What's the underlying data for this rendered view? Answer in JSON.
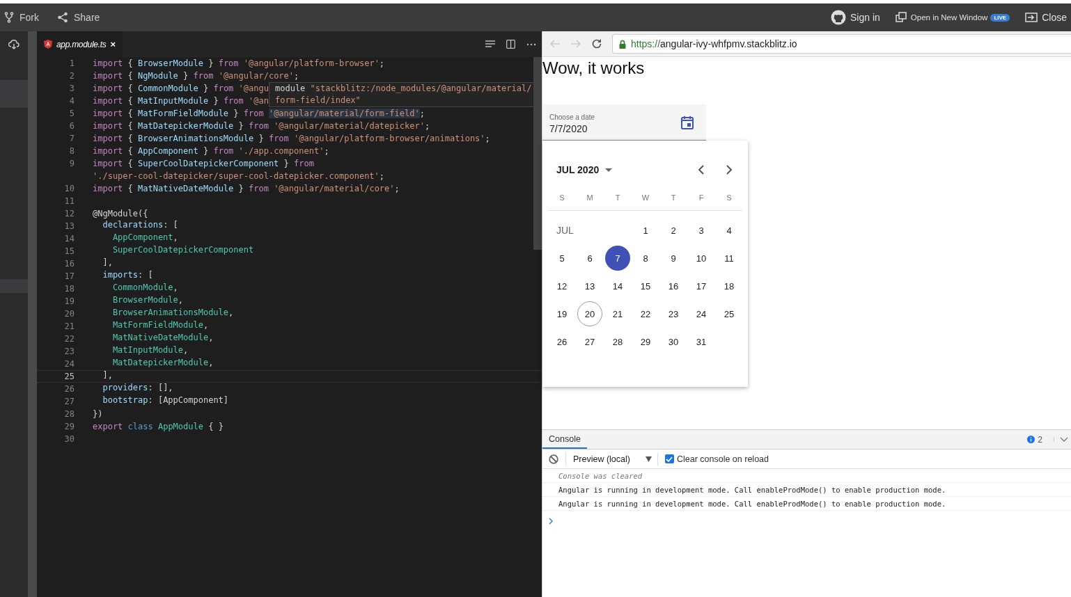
{
  "top_bar": {
    "left_actions": [
      {
        "label": "Fork"
      },
      {
        "label": "Share"
      }
    ],
    "right_actions": [
      {
        "label": "Sign in"
      },
      {
        "label": "Open in New Window",
        "badge": "LIVE"
      },
      {
        "label": "Close"
      }
    ]
  },
  "editor": {
    "tabs": [
      {
        "label": "app.module.ts",
        "close": "×",
        "selected": true
      }
    ],
    "lines": [
      {
        "num": "1",
        "current": false,
        "tokens": [
          {
            "kind": "kw",
            "text": "import"
          },
          {
            "kind": "p",
            "text": " { "
          },
          {
            "kind": "id",
            "text": "BrowserModule"
          },
          {
            "kind": "p",
            "text": " } "
          },
          {
            "kind": "kw",
            "text": "from"
          },
          {
            "kind": "str",
            "text": " '@angular/platform-browser'"
          },
          {
            "kind": "p",
            "text": ";"
          }
        ]
      },
      {
        "num": "2",
        "current": false,
        "tokens": [
          {
            "kind": "kw",
            "text": "import"
          },
          {
            "kind": "p",
            "text": " { "
          },
          {
            "kind": "id",
            "text": "NgModule"
          },
          {
            "kind": "p",
            "text": " } "
          },
          {
            "kind": "kw",
            "text": "from"
          },
          {
            "kind": "str",
            "text": " '@angular/core'"
          },
          {
            "kind": "p",
            "text": ";"
          }
        ]
      },
      {
        "num": "3",
        "current": false,
        "tokens": [
          {
            "kind": "kw",
            "text": "import"
          },
          {
            "kind": "p",
            "text": " { "
          },
          {
            "kind": "id",
            "text": "CommonModule"
          },
          {
            "kind": "p",
            "text": " } "
          },
          {
            "kind": "kw",
            "text": "from"
          },
          {
            "kind": "str",
            "text": " '@angu"
          }
        ]
      },
      {
        "num": "4",
        "current": false,
        "tokens": [
          {
            "kind": "kw",
            "text": "import"
          },
          {
            "kind": "p",
            "text": " { "
          },
          {
            "kind": "id",
            "text": "MatInputModule"
          },
          {
            "kind": "p",
            "text": " } "
          },
          {
            "kind": "kw",
            "text": "from"
          },
          {
            "kind": "str",
            "text": " '@an"
          }
        ]
      },
      {
        "num": "5",
        "current": false,
        "tokens": [
          {
            "kind": "kw",
            "text": "import"
          },
          {
            "kind": "p",
            "text": " { "
          },
          {
            "kind": "id",
            "text": "MatFormFieldModule"
          },
          {
            "kind": "p",
            "text": " } "
          },
          {
            "kind": "kw",
            "text": "from "
          },
          {
            "kind": "strhl",
            "text": "'@angular/material/form-field'"
          },
          {
            "kind": "p",
            "text": ";"
          }
        ]
      },
      {
        "num": "6",
        "current": false,
        "tokens": [
          {
            "kind": "kw",
            "text": "import"
          },
          {
            "kind": "p",
            "text": " { "
          },
          {
            "kind": "id",
            "text": "MatDatepickerModule"
          },
          {
            "kind": "p",
            "text": " } "
          },
          {
            "kind": "kw",
            "text": "from"
          },
          {
            "kind": "str",
            "text": " '@angular/material/datepicker'"
          },
          {
            "kind": "p",
            "text": ";"
          }
        ]
      },
      {
        "num": "7",
        "current": false,
        "tokens": [
          {
            "kind": "kw",
            "text": "import"
          },
          {
            "kind": "p",
            "text": " { "
          },
          {
            "kind": "id",
            "text": "BrowserAnimationsModule"
          },
          {
            "kind": "p",
            "text": " } "
          },
          {
            "kind": "kw",
            "text": "from"
          },
          {
            "kind": "str",
            "text": " '@angular/platform-browser/animations'"
          },
          {
            "kind": "p",
            "text": ";"
          }
        ]
      },
      {
        "num": "8",
        "current": false,
        "tokens": [
          {
            "kind": "kw",
            "text": "import"
          },
          {
            "kind": "p",
            "text": " { "
          },
          {
            "kind": "id",
            "text": "AppComponent"
          },
          {
            "kind": "p",
            "text": " } "
          },
          {
            "kind": "kw",
            "text": "from"
          },
          {
            "kind": "str",
            "text": " './app.component'"
          },
          {
            "kind": "p",
            "text": ";"
          }
        ]
      },
      {
        "num": "9",
        "current": false,
        "tokens": [
          {
            "kind": "kw",
            "text": "import"
          },
          {
            "kind": "p",
            "text": " { "
          },
          {
            "kind": "id",
            "text": "SuperCoolDatepickerComponent"
          },
          {
            "kind": "p",
            "text": " } "
          },
          {
            "kind": "kw",
            "text": "from"
          }
        ],
        "continuation": [
          {
            "kind": "str",
            "text": "'./super-cool-datepicker/super-cool-datepicker.component'"
          },
          {
            "kind": "p",
            "text": ";"
          }
        ]
      },
      {
        "num": "10",
        "current": false,
        "tokens": [
          {
            "kind": "kw",
            "text": "import"
          },
          {
            "kind": "p",
            "text": " { "
          },
          {
            "kind": "id",
            "text": "MatNativeDateModule"
          },
          {
            "kind": "p",
            "text": " } "
          },
          {
            "kind": "kw",
            "text": "from"
          },
          {
            "kind": "str",
            "text": " '@angular/material/core'"
          },
          {
            "kind": "p",
            "text": ";"
          }
        ]
      },
      {
        "num": "11",
        "current": false
      },
      {
        "num": "12",
        "current": false,
        "tokens": [
          {
            "kind": "p",
            "text": "@NgModule({"
          }
        ]
      },
      {
        "num": "13",
        "current": false,
        "tokens": [
          {
            "kind": "indent"
          },
          {
            "kind": "prop",
            "text": "declarations"
          },
          {
            "kind": "p",
            "text": ": ["
          }
        ]
      },
      {
        "num": "14",
        "current": false,
        "tokens": [
          {
            "kind": "indent"
          },
          {
            "kind": "indent"
          },
          {
            "kind": "type",
            "text": "AppComponent"
          },
          {
            "kind": "p",
            "text": ","
          }
        ]
      },
      {
        "num": "15",
        "current": false,
        "tokens": [
          {
            "kind": "indent"
          },
          {
            "kind": "indent"
          },
          {
            "kind": "type",
            "text": "SuperCoolDatepickerComponent"
          }
        ]
      },
      {
        "num": "16",
        "current": false,
        "tokens": [
          {
            "kind": "indent"
          },
          {
            "kind": "p",
            "text": "],"
          }
        ]
      },
      {
        "num": "17",
        "current": false,
        "tokens": [
          {
            "kind": "indent"
          },
          {
            "kind": "prop",
            "text": "imports"
          },
          {
            "kind": "p",
            "text": ": ["
          }
        ]
      },
      {
        "num": "18",
        "current": false,
        "tokens": [
          {
            "kind": "indent"
          },
          {
            "kind": "indent"
          },
          {
            "kind": "type",
            "text": "CommonModule"
          },
          {
            "kind": "p",
            "text": ","
          }
        ]
      },
      {
        "num": "19",
        "current": false,
        "tokens": [
          {
            "kind": "indent"
          },
          {
            "kind": "indent"
          },
          {
            "kind": "type",
            "text": "BrowserModule"
          },
          {
            "kind": "p",
            "text": ","
          }
        ]
      },
      {
        "num": "20",
        "current": false,
        "tokens": [
          {
            "kind": "indent"
          },
          {
            "kind": "indent"
          },
          {
            "kind": "type",
            "text": "BrowserAnimationsModule"
          },
          {
            "kind": "p",
            "text": ","
          }
        ]
      },
      {
        "num": "21",
        "current": false,
        "tokens": [
          {
            "kind": "indent"
          },
          {
            "kind": "indent"
          },
          {
            "kind": "type",
            "text": "MatFormFieldModule"
          },
          {
            "kind": "p",
            "text": ","
          }
        ]
      },
      {
        "num": "22",
        "current": false,
        "tokens": [
          {
            "kind": "indent"
          },
          {
            "kind": "indent"
          },
          {
            "kind": "type",
            "text": "MatNativeDateModule"
          },
          {
            "kind": "p",
            "text": ","
          }
        ]
      },
      {
        "num": "23",
        "current": false,
        "tokens": [
          {
            "kind": "indent"
          },
          {
            "kind": "indent"
          },
          {
            "kind": "type",
            "text": "MatInputModule"
          },
          {
            "kind": "p",
            "text": ","
          }
        ]
      },
      {
        "num": "24",
        "current": false,
        "tokens": [
          {
            "kind": "indent"
          },
          {
            "kind": "indent"
          },
          {
            "kind": "type",
            "text": "MatDatepickerModule"
          },
          {
            "kind": "p",
            "text": ","
          }
        ]
      },
      {
        "num": "25",
        "current": true,
        "tokens": [
          {
            "kind": "indent"
          },
          {
            "kind": "p",
            "text": "],"
          }
        ]
      },
      {
        "num": "26",
        "current": false,
        "tokens": [
          {
            "kind": "indent"
          },
          {
            "kind": "prop",
            "text": "providers"
          },
          {
            "kind": "p",
            "text": ": [],"
          }
        ]
      },
      {
        "num": "27",
        "current": false,
        "tokens": [
          {
            "kind": "indent"
          },
          {
            "kind": "prop",
            "text": "bootstrap"
          },
          {
            "kind": "p",
            "text": ": [AppComponent]"
          }
        ]
      },
      {
        "num": "28",
        "current": false,
        "tokens": [
          {
            "kind": "p",
            "text": "})"
          }
        ]
      },
      {
        "num": "29",
        "current": false,
        "tokens": [
          {
            "kind": "kw",
            "text": "export "
          },
          {
            "kind": "cls",
            "text": "class "
          },
          {
            "kind": "type",
            "text": "AppModule"
          },
          {
            "kind": "p",
            "text": " { }"
          }
        ]
      },
      {
        "num": "30",
        "current": false
      }
    ],
    "tooltip": {
      "lines": [
        [
          {
            "kind": "p",
            "text": "module "
          },
          {
            "kind": "str",
            "text": "\"stackblitz:/node_modules/@angular/material/"
          }
        ],
        [
          {
            "kind": "str",
            "text": "form-field/index\""
          }
        ]
      ]
    }
  },
  "browser": {
    "url_scheme": "https://",
    "url_rest": "angular-ivy-whfpmv.stackblitz.io"
  },
  "page": {
    "heading": "Wow, it works",
    "date_field": {
      "label": "Choose a date",
      "value": "7/7/2020"
    },
    "calendar": {
      "period": "JUL 2020",
      "weekdays": [
        "S",
        "M",
        "T",
        "W",
        "T",
        "F",
        "S"
      ],
      "weeks": [
        {
          "month_label": "JUL",
          "days": [
            {
              "text": "1",
              "selected": false,
              "today": false
            },
            {
              "text": "2",
              "selected": false,
              "today": false
            },
            {
              "text": "3",
              "selected": false,
              "today": false
            },
            {
              "text": "4",
              "selected": false,
              "today": false
            }
          ]
        },
        {
          "days": [
            {
              "text": "5",
              "selected": false,
              "today": false
            },
            {
              "text": "6",
              "selected": false,
              "today": false
            },
            {
              "text": "7",
              "selected": true,
              "today": false
            },
            {
              "text": "8",
              "selected": false,
              "today": false
            },
            {
              "text": "9",
              "selected": false,
              "today": false
            },
            {
              "text": "10",
              "selected": false,
              "today": false
            },
            {
              "text": "11",
              "selected": false,
              "today": false
            }
          ]
        },
        {
          "days": [
            {
              "text": "12",
              "selected": false,
              "today": false
            },
            {
              "text": "13",
              "selected": false,
              "today": false
            },
            {
              "text": "14",
              "selected": false,
              "today": false
            },
            {
              "text": "15",
              "selected": false,
              "today": false
            },
            {
              "text": "16",
              "selected": false,
              "today": false
            },
            {
              "text": "17",
              "selected": false,
              "today": false
            },
            {
              "text": "18",
              "selected": false,
              "today": false
            }
          ]
        },
        {
          "days": [
            {
              "text": "19",
              "selected": false,
              "today": false
            },
            {
              "text": "20",
              "selected": false,
              "today": true
            },
            {
              "text": "21",
              "selected": false,
              "today": false
            },
            {
              "text": "22",
              "selected": false,
              "today": false
            },
            {
              "text": "23",
              "selected": false,
              "today": false
            },
            {
              "text": "24",
              "selected": false,
              "today": false
            },
            {
              "text": "25",
              "selected": false,
              "today": false
            }
          ]
        },
        {
          "days": [
            {
              "text": "26",
              "selected": false,
              "today": false
            },
            {
              "text": "27",
              "selected": false,
              "today": false
            },
            {
              "text": "28",
              "selected": false,
              "today": false
            },
            {
              "text": "29",
              "selected": false,
              "today": false
            },
            {
              "text": "30",
              "selected": false,
              "today": false
            },
            {
              "text": "31",
              "selected": false,
              "today": false
            }
          ]
        }
      ]
    }
  },
  "console": {
    "tabs": [
      {
        "label": "Console",
        "selected": true
      }
    ],
    "info_count": "2",
    "context": "Preview (local)",
    "clear_on_reload": {
      "label": "Clear console on reload",
      "checked": true
    },
    "messages": [
      {
        "kind": "info",
        "text": "Console was cleared"
      },
      {
        "kind": "log",
        "text": "Angular is running in development mode. Call enableProdMode() to enable production mode."
      },
      {
        "kind": "log",
        "text": "Angular is running in development mode. Call enableProdMode() to enable production mode."
      }
    ]
  }
}
